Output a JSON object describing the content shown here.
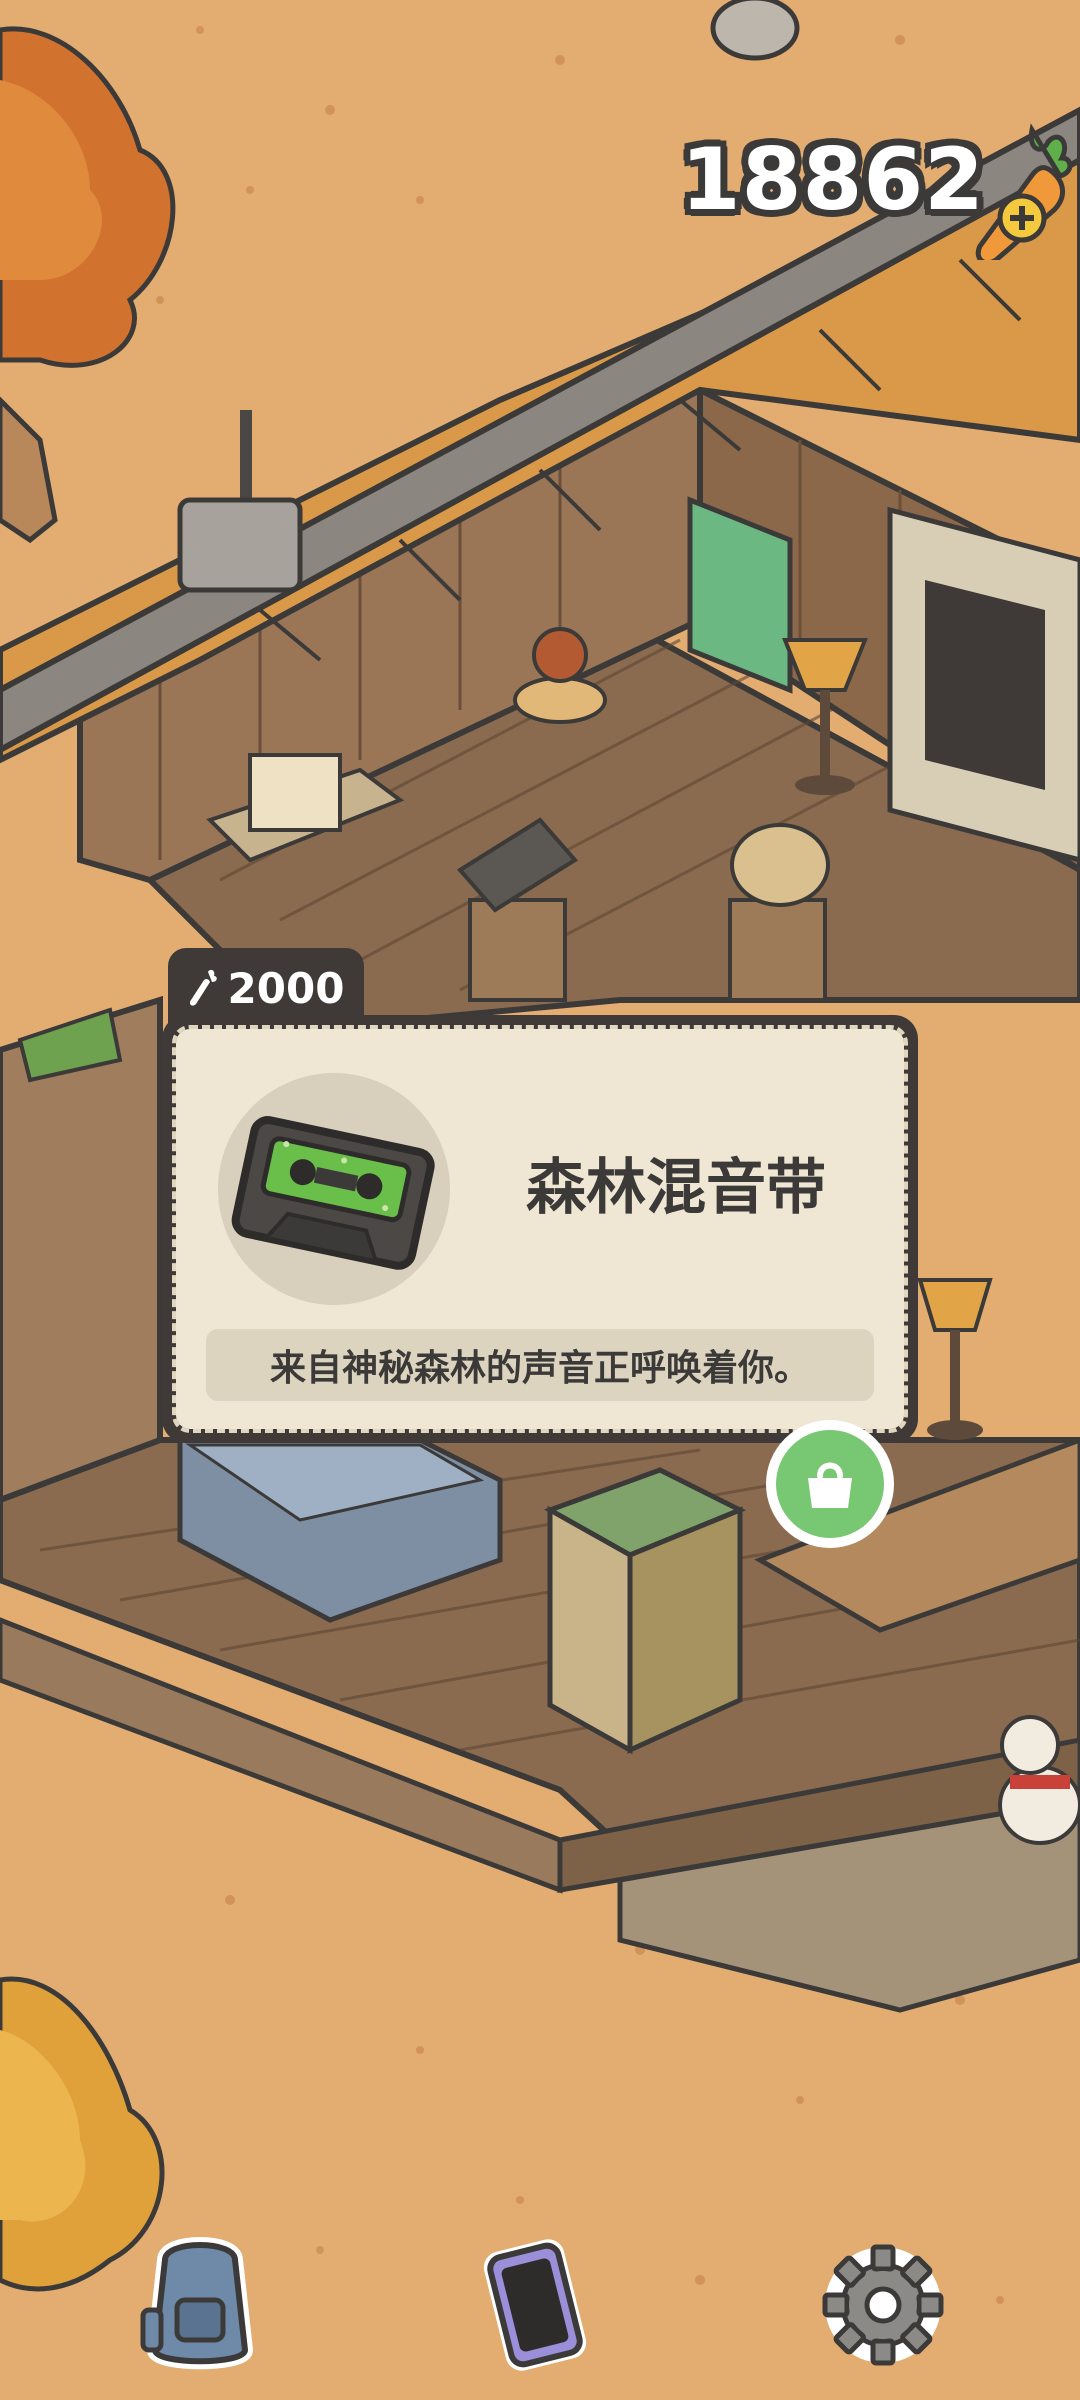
{
  "hud": {
    "carrot_count": "18862",
    "icons": {
      "currency": "carrot-plus-icon"
    }
  },
  "popup": {
    "price": "2000",
    "item_name": "森林混音带",
    "description": "来自神秘森林的声音正呼唤着你。",
    "icons": {
      "price": "carrot-icon",
      "item": "cassette-tape-icon",
      "shop": "shopping-bag-icon"
    }
  },
  "toolbar": {
    "icons": [
      "backpack-icon",
      "phone-icon",
      "gear-icon"
    ]
  },
  "colors": {
    "ground": "#e3ad72",
    "popup_frame": "#3f3a37",
    "popup_body": "#efe7d3",
    "accent_green": "#78c873"
  }
}
